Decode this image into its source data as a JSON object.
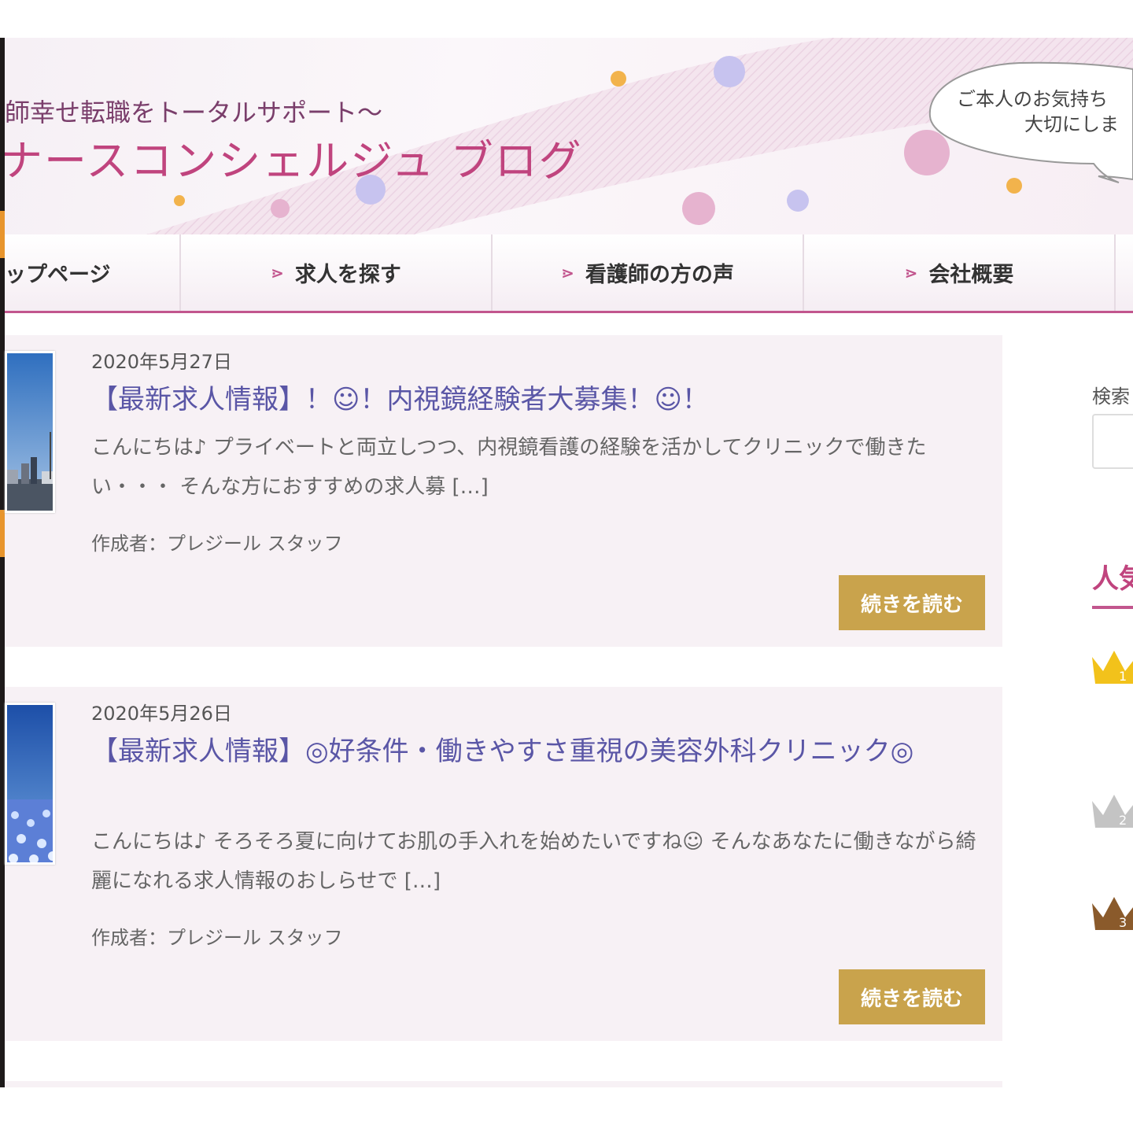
{
  "header": {
    "tagline": "師幸せ転職をトータルサポート～",
    "site_title": "ナースコンシェルジュ ブログ",
    "bubble_line1": "ご本人のお気持ち",
    "bubble_line2": "大切にしま"
  },
  "nav": {
    "items": [
      {
        "label": "ップページ"
      },
      {
        "label": "求人を探す"
      },
      {
        "label": "看護師の方の声"
      },
      {
        "label": "会社概要"
      }
    ]
  },
  "posts": [
    {
      "date": "2020年5月27日",
      "title": "【最新求人情報】！☺！内視鏡経験者大募集！☺！",
      "excerpt": "こんにちは♪ プライベートと両立しつつ、内視鏡看護の経験を活かしてクリニックで働きたい・・・ そんな方におすすめの求人募 […]",
      "author": "作成者：プレジール スタッフ",
      "more_label": "続きを読む"
    },
    {
      "date": "2020年5月26日",
      "title": "【最新求人情報】◎好条件・働きやすさ重視の美容外科クリニック◎",
      "excerpt": "こんにちは♪ そろそろ夏に向けてお肌の手入れを始めたいですね☺ そんなあなたに働きながら綺麗になれる求人情報のおしらせで […]",
      "author": "作成者：プレジール スタッフ",
      "more_label": "続きを読む"
    }
  ],
  "sidebar": {
    "search_label": "検索",
    "popular_title": "人気",
    "ranks": [
      "1",
      "2",
      "3"
    ]
  },
  "colors": {
    "accent": "#c2568e",
    "title_pink": "#c0447e",
    "post_title": "#5a56a6",
    "button_gold": "#c9a34c",
    "post_bg": "#f7f1f5"
  }
}
